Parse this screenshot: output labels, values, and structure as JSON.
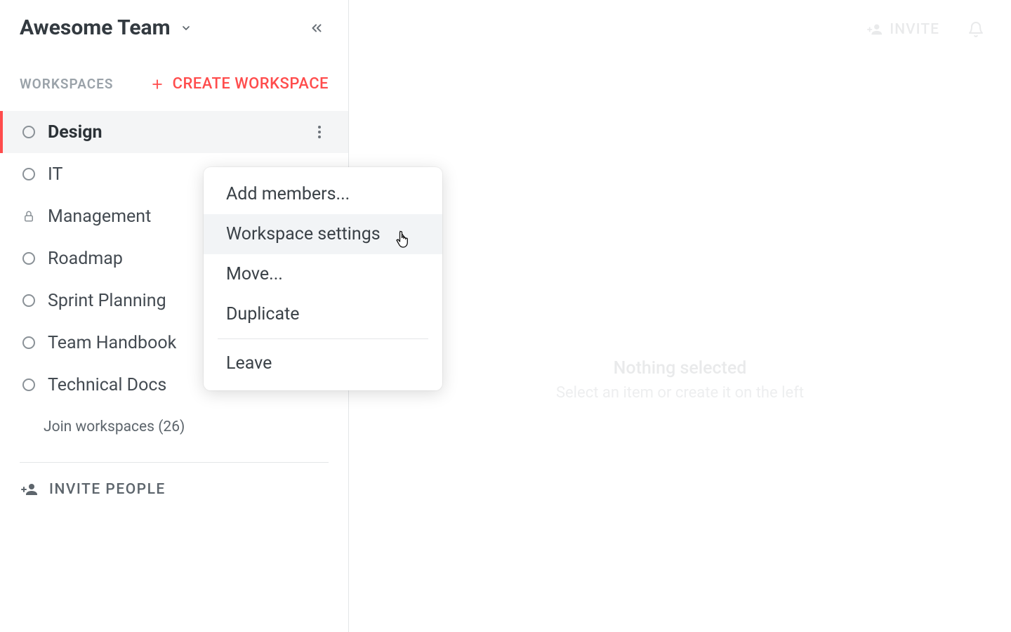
{
  "team": {
    "name": "Awesome Team"
  },
  "sidebar": {
    "workspaces_label": "WORKSPACES",
    "create_label": "CREATE WORKSPACE",
    "items": [
      {
        "name": "Design",
        "icon": "circle",
        "active": true
      },
      {
        "name": "IT",
        "icon": "circle",
        "active": false
      },
      {
        "name": "Management",
        "icon": "lock",
        "active": false
      },
      {
        "name": "Roadmap",
        "icon": "circle",
        "active": false
      },
      {
        "name": "Sprint Planning",
        "icon": "circle",
        "active": false
      },
      {
        "name": "Team Handbook",
        "icon": "circle",
        "active": false
      },
      {
        "name": "Technical Docs",
        "icon": "circle",
        "active": false
      }
    ],
    "join_label": "Join workspaces (26)",
    "invite_label": "INVITE PEOPLE"
  },
  "context_menu": {
    "items": [
      {
        "label": "Add members...",
        "hover": false
      },
      {
        "label": "Workspace settings",
        "hover": true
      },
      {
        "label": "Move...",
        "hover": false
      },
      {
        "label": "Duplicate",
        "hover": false
      }
    ],
    "leave_label": "Leave"
  },
  "main": {
    "invite_label": "INVITE",
    "empty_title": "Nothing selected",
    "empty_sub": "Select an item or create it on the left"
  },
  "colors": {
    "accent": "#ff4c4c"
  }
}
